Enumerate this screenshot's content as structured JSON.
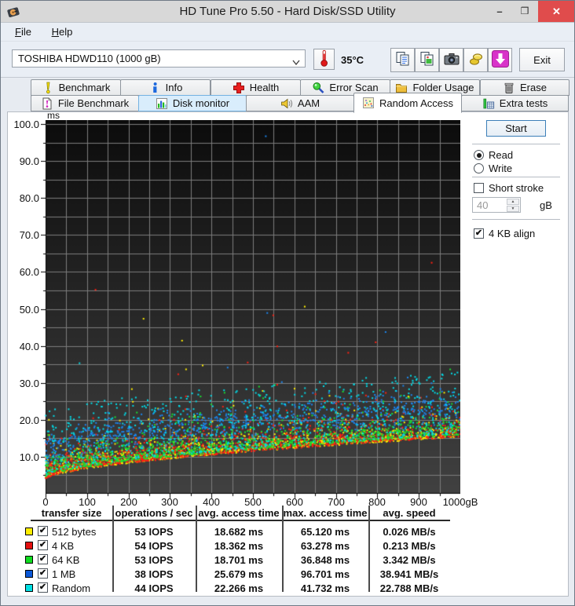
{
  "window": {
    "title": "HD Tune Pro 5.50 - Hard Disk/SSD Utility",
    "controls": {
      "minimize": "–",
      "maximize": "❒",
      "close": "✕"
    }
  },
  "menu": {
    "items": [
      {
        "label": "File"
      },
      {
        "label": "Help"
      }
    ]
  },
  "toolbar": {
    "drive_selector": {
      "value": "TOSHIBA HDWD110 (1000 gB)"
    },
    "temperature": "35°C",
    "buttons": [
      {
        "icon": "copy-text-icon"
      },
      {
        "icon": "copy-image-icon"
      },
      {
        "icon": "camera-icon"
      },
      {
        "icon": "donate-icon"
      },
      {
        "icon": "update-icon"
      }
    ],
    "exit_label": "Exit"
  },
  "tabs": {
    "row1": [
      {
        "label": "Benchmark",
        "icon": "benchmark-icon"
      },
      {
        "label": "Info",
        "icon": "info-icon"
      },
      {
        "label": "Health",
        "icon": "health-icon"
      },
      {
        "label": "Error Scan",
        "icon": "error-scan-icon"
      },
      {
        "label": "Folder Usage",
        "icon": "folder-usage-icon"
      },
      {
        "label": "Erase",
        "icon": "erase-icon"
      }
    ],
    "row2": [
      {
        "label": "File Benchmark",
        "icon": "file-benchmark-icon"
      },
      {
        "label": "Disk monitor",
        "icon": "disk-monitor-icon",
        "hover": true
      },
      {
        "label": "AAM",
        "icon": "aam-icon"
      },
      {
        "label": "Random Access",
        "icon": "random-access-icon",
        "active": true
      },
      {
        "label": "Extra tests",
        "icon": "extra-tests-icon"
      }
    ]
  },
  "controls": {
    "start_label": "Start",
    "read_label": "Read",
    "write_label": "Write",
    "read_selected": true,
    "short_stroke_label": "Short stroke",
    "short_stroke_checked": false,
    "stroke_size_value": "40",
    "stroke_size_unit": "gB",
    "align_label": "4 KB align",
    "align_checked": true
  },
  "table": {
    "headers": [
      "transfer size",
      "operations / sec",
      "avg. access time",
      "max. access time",
      "avg. speed"
    ],
    "rows": [
      {
        "color": "#ffee00",
        "checked": true,
        "label": "512 bytes",
        "ops": "53 IOPS",
        "avg": "18.682 ms",
        "max": "65.120 ms",
        "speed": "0.026 MB/s"
      },
      {
        "color": "#e41010",
        "checked": true,
        "label": "4 KB",
        "ops": "54 IOPS",
        "avg": "18.362 ms",
        "max": "63.278 ms",
        "speed": "0.213 MB/s"
      },
      {
        "color": "#10dc20",
        "checked": true,
        "label": "64 KB",
        "ops": "53 IOPS",
        "avg": "18.701 ms",
        "max": "36.848 ms",
        "speed": "3.342 MB/s"
      },
      {
        "color": "#0a58d8",
        "checked": true,
        "label": "1 MB",
        "ops": "38 IOPS",
        "avg": "25.679 ms",
        "max": "96.701 ms",
        "speed": "38.941 MB/s"
      },
      {
        "color": "#00e0e4",
        "checked": true,
        "label": "Random",
        "ops": "44 IOPS",
        "avg": "22.266 ms",
        "max": "41.732 ms",
        "speed": "22.788 MB/s"
      }
    ]
  },
  "chart_data": {
    "type": "scatter",
    "title": "Random Access: access time (ms) vs disk position (gB)",
    "xlabel": "gB",
    "ylabel": "ms",
    "x_range": [
      0,
      1000
    ],
    "y_range": [
      0,
      101
    ],
    "x_grid_step": 50,
    "y_grid_step": 5,
    "grid": true,
    "legend_position": "bottom-table",
    "x_tick_labels": [
      "0",
      "100",
      "200",
      "300",
      "400",
      "500",
      "600",
      "700",
      "800",
      "900",
      "1000gB"
    ],
    "y_tick_labels": [
      "100.0",
      "90.0",
      "80.0",
      "70.0",
      "60.0",
      "50.0",
      "40.0",
      "30.0",
      "20.0",
      "10.0"
    ],
    "background": {
      "top": "#0c0c0c",
      "bottom": "#414141",
      "grid": "#7d7d7d"
    },
    "envelope": {
      "y_at_0": 3.6,
      "y_at_1000": 15.0,
      "exponent": 0.6
    },
    "seed": 1337,
    "series": [
      {
        "name": "512 bytes",
        "color": "#ffee00",
        "points": 1050,
        "offset": 0.3,
        "spread": 5.5,
        "dist": "exp",
        "outlier_rate": 0.006,
        "outlier_max": 65.1,
        "avg_ms": 18.682,
        "max_ms": 65.12
      },
      {
        "name": "4 KB",
        "color": "#ff2012",
        "points": 1050,
        "offset": 0.3,
        "spread": 5.5,
        "dist": "exp",
        "outlier_rate": 0.006,
        "outlier_max": 63.3,
        "avg_ms": 18.362,
        "max_ms": 63.278
      },
      {
        "name": "64 KB",
        "color": "#18e030",
        "points": 1050,
        "offset": 0.8,
        "spread": 6.0,
        "dist": "exp",
        "outlier_rate": 0.004,
        "outlier_max": 36.8,
        "avg_ms": 18.701,
        "max_ms": 36.848
      },
      {
        "name": "1 MB",
        "color": "#1b86f0",
        "points": 760,
        "offset": 8.5,
        "spread": 4.2,
        "dist": "gauss",
        "outlier_rate": 0.008,
        "outlier_max": 52.0,
        "avg_ms": 25.679,
        "max_ms": 96.701,
        "extra_points": [
          [
            531,
            96.7
          ]
        ]
      },
      {
        "name": "Random",
        "color": "#00dce8",
        "points": 760,
        "offset": 1.2,
        "spread": 17.0,
        "dist": "pow",
        "outlier_rate": 0.006,
        "outlier_max": 41.7,
        "avg_ms": 22.266,
        "max_ms": 41.732
      }
    ]
  }
}
